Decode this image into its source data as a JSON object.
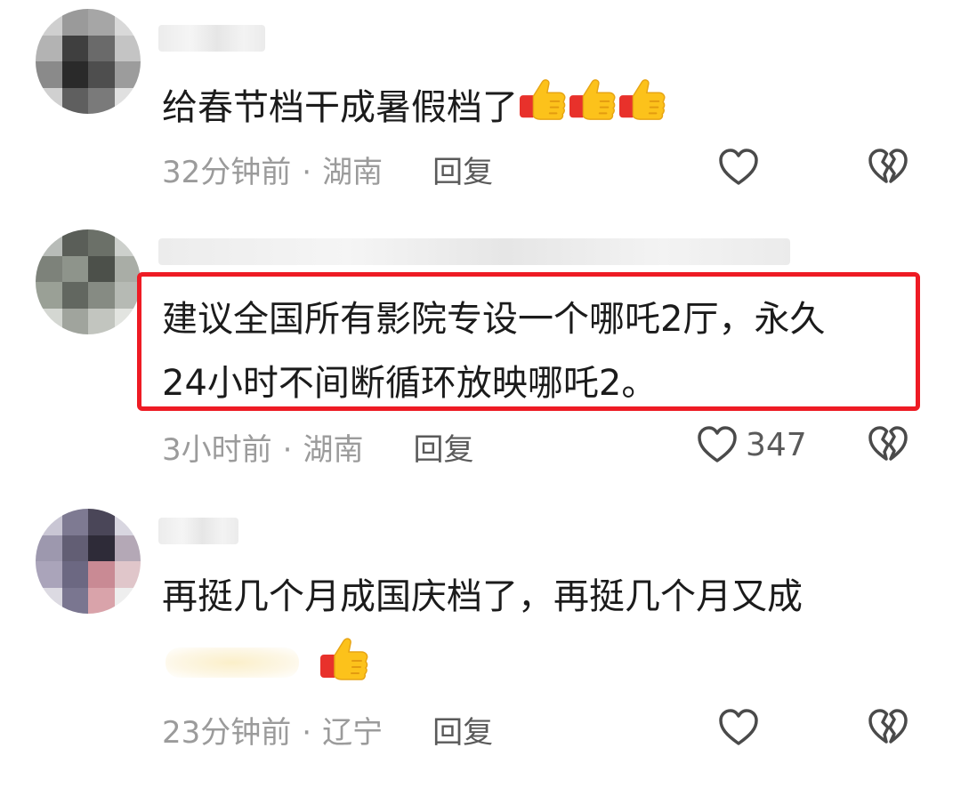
{
  "comments": [
    {
      "text": "给春节档干成暑假档了",
      "emoji_after_text": [
        "thumbs-up",
        "thumbs-up",
        "thumbs-up"
      ],
      "time": "32分钟前",
      "location": "湖南",
      "reply_label": "回复",
      "like_count": ""
    },
    {
      "text_line1": "建议全国所有影院专设一个哪吒2厅，永久",
      "text_line2": "24小时不间断循环放映哪吒2。",
      "highlighted": true,
      "time": "3小时前",
      "location": "湖南",
      "reply_label": "回复",
      "like_count": "347"
    },
    {
      "text": "再挺几个月成国庆档了，再挺几个月又成",
      "emoji_after_text": [
        "thumbs-up"
      ],
      "time": "23分钟前",
      "location": "辽宁",
      "reply_label": "回复",
      "like_count": ""
    }
  ],
  "separator": "·",
  "icons": {
    "like": "heart-outline-icon",
    "dislike": "broken-heart-icon",
    "reaction": "thumbs-up-emoji"
  },
  "colors": {
    "highlight_border": "#ee1b24",
    "meta_text": "#9b9b9b",
    "icon_stroke": "#4a4a4a"
  }
}
